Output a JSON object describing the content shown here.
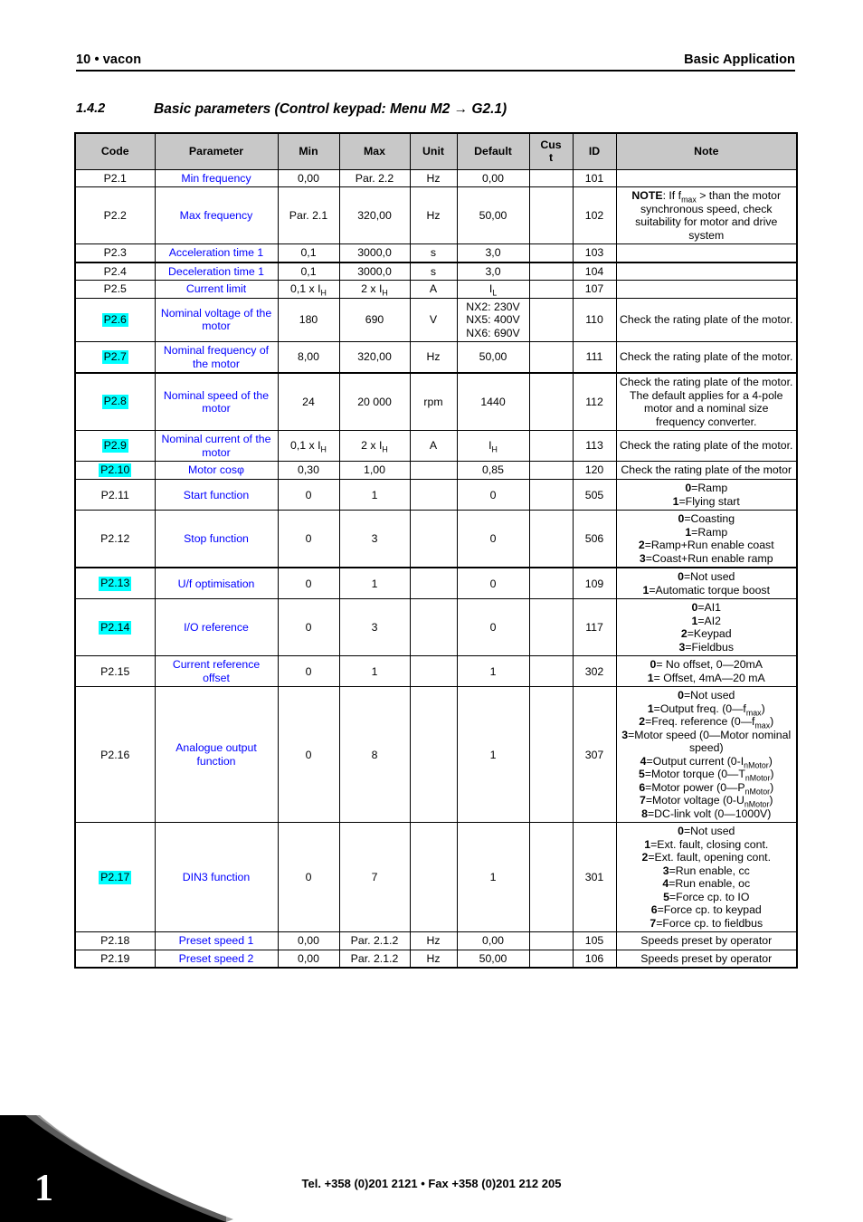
{
  "header": {
    "left": "10 • vacon",
    "right": "Basic Application"
  },
  "section": {
    "number": "1.4.2",
    "title": "Basic parameters (Control keypad: Menu M2 → G2.1)"
  },
  "table": {
    "columns": [
      "Code",
      "Parameter",
      "Min",
      "Max",
      "Unit",
      "Default",
      "Cus t",
      "ID",
      "Note"
    ],
    "rows": [
      {
        "code": "P2.1",
        "highlight": false,
        "parameter": "Min frequency",
        "min": "0,00",
        "max": "Par. 2.2",
        "unit": "Hz",
        "default": "0,00",
        "cust": "",
        "id": "101",
        "note": []
      },
      {
        "code": "P2.2",
        "highlight": false,
        "parameter": "Max frequency",
        "min": "Par. 2.1",
        "max": "320,00",
        "unit": "Hz",
        "default": "50,00",
        "cust": "",
        "id": "102",
        "note": [
          "NOTE: If fmax > than the motor synchronous speed, check suitability for motor and drive system"
        ]
      },
      {
        "code": "P2.3",
        "highlight": false,
        "parameter": "Acceleration time 1",
        "min": "0,1",
        "max": "3000,0",
        "unit": "s",
        "default": "3,0",
        "cust": "",
        "id": "103",
        "note": []
      },
      {
        "code": "P2.4",
        "highlight": false,
        "parameter": "Deceleration time 1",
        "min": "0,1",
        "max": "3000,0",
        "unit": "s",
        "default": "3,0",
        "cust": "",
        "id": "104",
        "note": []
      },
      {
        "code": "P2.5",
        "highlight": false,
        "parameter": "Current limit",
        "min": "0,1 x IH",
        "max": "2 x IH",
        "unit": "A",
        "default": "IL",
        "cust": "",
        "id": "107",
        "note": []
      },
      {
        "code": "P2.6",
        "highlight": true,
        "parameter": "Nominal voltage of the motor",
        "min": "180",
        "max": "690",
        "unit": "V",
        "default": "NX2: 230V NX5: 400V NX6: 690V",
        "cust": "",
        "id": "110",
        "note": [
          "Check the rating plate of the motor."
        ]
      },
      {
        "code": "P2.7",
        "highlight": true,
        "parameter": "Nominal frequency of the motor",
        "min": "8,00",
        "max": "320,00",
        "unit": "Hz",
        "default": "50,00",
        "cust": "",
        "id": "111",
        "note": [
          "Check the rating plate of the motor."
        ]
      },
      {
        "code": "P2.8",
        "highlight": true,
        "parameter": "Nominal speed of the motor",
        "min": "24",
        "max": "20 000",
        "unit": "rpm",
        "default": "1440",
        "cust": "",
        "id": "112",
        "note": [
          "Check the rating plate of the motor.",
          "The default applies for a 4-pole motor and a nominal size frequency converter."
        ]
      },
      {
        "code": "P2.9",
        "highlight": true,
        "parameter": "Nominal current of the motor",
        "min": "0,1 x IH",
        "max": "2 x IH",
        "unit": "A",
        "default": "IH",
        "cust": "",
        "id": "113",
        "note": [
          "Check the rating plate of the motor."
        ]
      },
      {
        "code": "P2.10",
        "highlight": true,
        "parameter": "Motor cosφ",
        "min": "0,30",
        "max": "1,00",
        "unit": "",
        "default": "0,85",
        "cust": "",
        "id": "120",
        "note": [
          "Check the rating plate of the motor"
        ]
      },
      {
        "code": "P2.11",
        "highlight": false,
        "parameter": "Start function",
        "min": "0",
        "max": "1",
        "unit": "",
        "default": "0",
        "cust": "",
        "id": "505",
        "note": [
          "0=Ramp",
          "1=Flying start"
        ]
      },
      {
        "code": "P2.12",
        "highlight": false,
        "parameter": "Stop function",
        "min": "0",
        "max": "3",
        "unit": "",
        "default": "0",
        "cust": "",
        "id": "506",
        "note": [
          "0=Coasting",
          "1=Ramp",
          "2=Ramp+Run enable coast",
          "3=Coast+Run enable ramp"
        ]
      },
      {
        "code": "P2.13",
        "highlight": true,
        "parameter": "U/f optimisation",
        "min": "0",
        "max": "1",
        "unit": "",
        "default": "0",
        "cust": "",
        "id": "109",
        "note": [
          "0=Not used",
          "1=Automatic torque boost"
        ]
      },
      {
        "code": "P2.14",
        "highlight": true,
        "parameter": "I/O reference",
        "min": "0",
        "max": "3",
        "unit": "",
        "default": "0",
        "cust": "",
        "id": "117",
        "note": [
          "0=AI1",
          "1=AI2",
          "2=Keypad",
          "3=Fieldbus"
        ]
      },
      {
        "code": "P2.15",
        "highlight": false,
        "parameter": "Current reference offset",
        "min": "0",
        "max": "1",
        "unit": "",
        "default": "1",
        "cust": "",
        "id": "302",
        "note": [
          "0= No offset, 0—20mA",
          "1= Offset, 4mA—20 mA"
        ]
      },
      {
        "code": "P2.16",
        "highlight": false,
        "parameter": "Analogue output function",
        "min": "0",
        "max": "8",
        "unit": "",
        "default": "1",
        "cust": "",
        "id": "307",
        "note": [
          "0=Not used",
          "1=Output freq. (0—fmax)",
          "2=Freq. reference (0—fmax)",
          "3=Motor speed (0—Motor nominal speed)",
          "4=Output current (0-InMotor)",
          "5=Motor torque (0—TnMotor)",
          "6=Motor power (0—PnMotor)",
          "7=Motor voltage (0-UnMotor)",
          "8=DC-link volt (0—1000V)"
        ]
      },
      {
        "code": "P2.17",
        "highlight": true,
        "parameter": "DIN3 function",
        "min": "0",
        "max": "7",
        "unit": "",
        "default": "1",
        "cust": "",
        "id": "301",
        "note": [
          "0=Not used",
          "1=Ext. fault, closing cont.",
          "2=Ext. fault, opening cont.",
          "3=Run enable, cc",
          "4=Run enable, oc",
          "5=Force cp. to IO",
          "6=Force cp. to keypad",
          "7=Force cp. to fieldbus"
        ]
      },
      {
        "code": "P2.18",
        "highlight": false,
        "parameter": "Preset speed 1",
        "min": "0,00",
        "max": "Par. 2.1.2",
        "unit": "Hz",
        "default": "0,00",
        "cust": "",
        "id": "105",
        "note": [
          "Speeds preset by operator"
        ]
      },
      {
        "code": "P2.19",
        "highlight": false,
        "parameter": "Preset speed 2",
        "min": "0,00",
        "max": "Par. 2.1.2",
        "unit": "Hz",
        "default": "50,00",
        "cust": "",
        "id": "106",
        "note": [
          "Speeds preset by operator"
        ]
      }
    ]
  },
  "footer": {
    "contact": "Tel. +358 (0)201 2121 • Fax +358 (0)201 212 205",
    "page_number": "1"
  },
  "colors": {
    "parameter_link": "#0000FF",
    "highlight": "#00FFFF",
    "header_fill": "#C8C8C8"
  }
}
